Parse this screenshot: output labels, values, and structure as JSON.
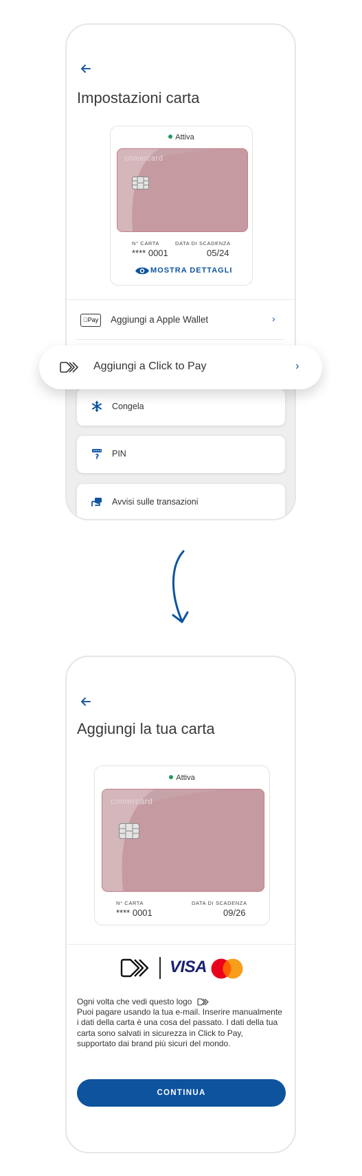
{
  "screen1": {
    "title": "Impostazioni carta",
    "card": {
      "status": "Attiva",
      "brand": "comercard",
      "number_label": "N° CARTA",
      "number": "**** 0001",
      "expiry_label": "DATA DI SCADENZA",
      "expiry": "05/24",
      "show_details": "MOSTRA DETTAGLI"
    },
    "apple_pay_badge": "Pay",
    "apple_wallet_label": "Aggiungi a Apple Wallet",
    "click_to_pay_label": "Aggiungi a Click to Pay",
    "tiles": [
      {
        "label": "Congela",
        "icon": "snowflake-icon"
      },
      {
        "label": "PIN",
        "icon": "pin-icon"
      },
      {
        "label": "Avvisi sulle transazioni",
        "icon": "notification-icon"
      }
    ]
  },
  "screen2": {
    "title": "Aggiungi la tua carta",
    "card": {
      "status": "Attiva",
      "brand": "comercard",
      "number_label": "N° CARTA",
      "number": "**** 0001",
      "expiry_label": "DATA DI SCADENZA",
      "expiry": "09/26"
    },
    "visa_label": "VISA",
    "paragraph_line1": "Ogni volta che vedi questo logo",
    "paragraph_rest": "Puoi pagare usando la tua e-mail. Inserire manualmente i dati della carta è una cosa del passato. I dati della tua carta sono salvati in sicurezza in Click to Pay, supportato dai brand più sicuri del mondo.",
    "continue_label": "CONTINUA"
  },
  "colors": {
    "accent": "#0d539e",
    "active_dot": "#1e9b5b",
    "card_fill": "#c6a3a8",
    "mastercard_red": "#eb001b",
    "mastercard_orange": "#f79e1b"
  }
}
